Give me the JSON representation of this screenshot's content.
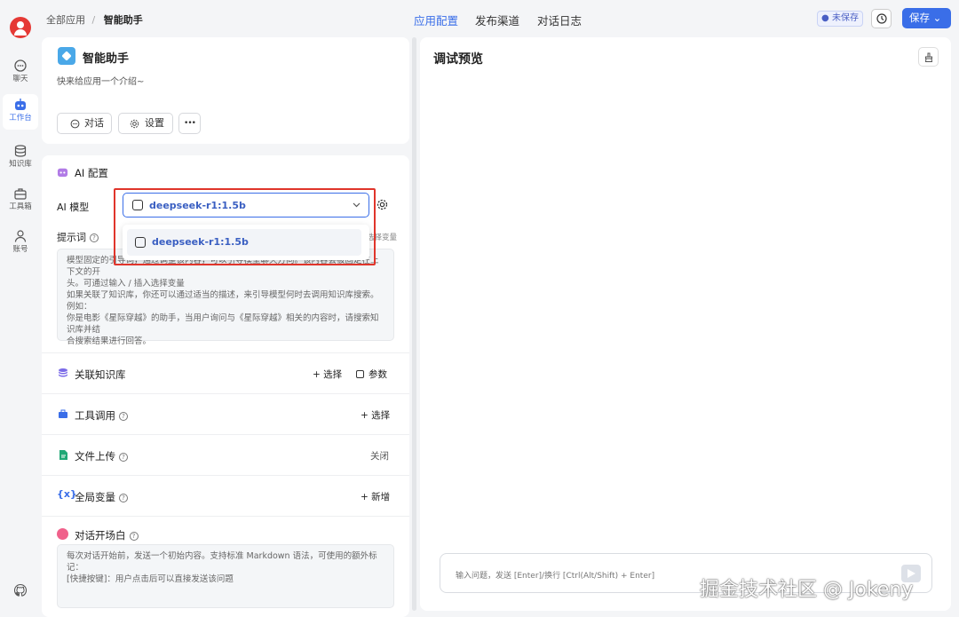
{
  "breadcrumb": {
    "root": "全部应用",
    "sep": "/",
    "current": "智能助手"
  },
  "topnav": {
    "tabs": [
      "应用配置",
      "发布渠道",
      "对话日志"
    ],
    "active_index": 0
  },
  "status": {
    "unsaved": "● 未保存",
    "save": "保存 ⌄"
  },
  "sidebar": {
    "items": [
      {
        "label": "聊天",
        "icon": "chat-icon"
      },
      {
        "label": "工作台",
        "icon": "robot-icon",
        "active": true
      },
      {
        "label": "知识库",
        "icon": "database-icon"
      },
      {
        "label": "工具箱",
        "icon": "toolbox-icon"
      },
      {
        "label": "账号",
        "icon": "user-icon"
      }
    ]
  },
  "app": {
    "name": "智能助手",
    "intro": "快来给应用一个介绍~",
    "buttons": {
      "chat": "对话",
      "settings": "设置",
      "more": "•••"
    }
  },
  "ai_config": {
    "title": "AI 配置",
    "model_label": "AI 模型",
    "model_value": "deepseek-r1:1.5b",
    "dropdown_option": "deepseek-r1:1.5b",
    "prompt_label": "提示词",
    "prompt_var_hint": "选择变量",
    "prompt_placeholder": [
      "模型固定的引导词，通过调整该内容，可以引导模型聊天方向。该内容会被固定在上下文的开",
      "头。可通过输入 / 插入选择变量",
      "如果关联了知识库，你还可以通过适当的描述，来引导模型何时去调用知识库搜索。例如：",
      "你是电影《星际穿越》的助手，当用户询问与《星际穿越》相关的内容时，请搜索知识库并结",
      "合搜索结果进行回答。"
    ]
  },
  "sections": {
    "kb": {
      "title": "关联知识库",
      "select": "+ 选择",
      "params": "参数"
    },
    "tools": {
      "title": "工具调用",
      "select": "+ 选择"
    },
    "upload": {
      "title": "文件上传",
      "value": "关闭"
    },
    "vars": {
      "title": "全局变量",
      "add": "+ 新增"
    },
    "opening": {
      "title": "对话开场白",
      "placeholder": [
        "每次对话开始前，发送一个初始内容。支持标准 Markdown 语法，可使用的额外标记：",
        "[快捷按键]：用户点击后可以直接发送该问题"
      ]
    }
  },
  "preview": {
    "title": "调试预览",
    "input_placeholder": "输入问题，发送 [Enter]/换行 [Ctrl(Alt/Shift) + Enter]"
  },
  "watermark": "掘金技术社区 @ Jokeny",
  "colors": {
    "accent": "#3a6ee8",
    "highlight": "#e0352b"
  }
}
